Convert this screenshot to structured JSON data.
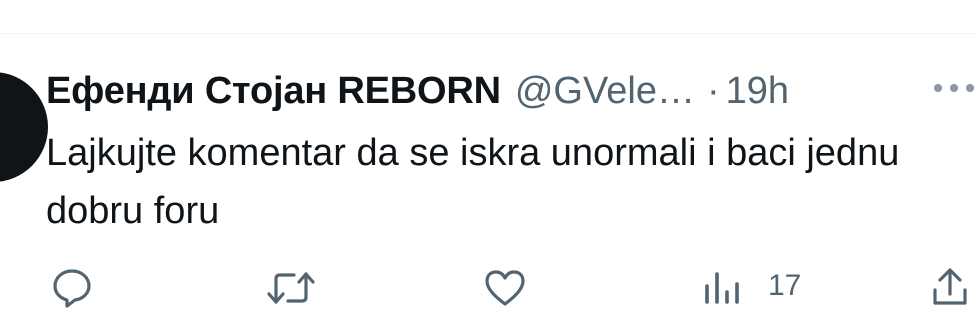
{
  "tweet": {
    "display_name": "Ефенди Стојан REBORN",
    "handle": "@GVele…",
    "separator": "·",
    "time": "19h",
    "text": "Lajkujte komentar da se iskra unormali i baci jednu dobru foru"
  },
  "actions": {
    "reply_icon": "reply-icon",
    "retweet_icon": "retweet-icon",
    "like_icon": "heart-icon",
    "views_icon": "views-bar-chart-icon",
    "views_count": "17",
    "share_icon": "share-icon"
  },
  "colors": {
    "text": "#0f1419",
    "secondary": "#536471",
    "divider": "#eff3f4"
  }
}
